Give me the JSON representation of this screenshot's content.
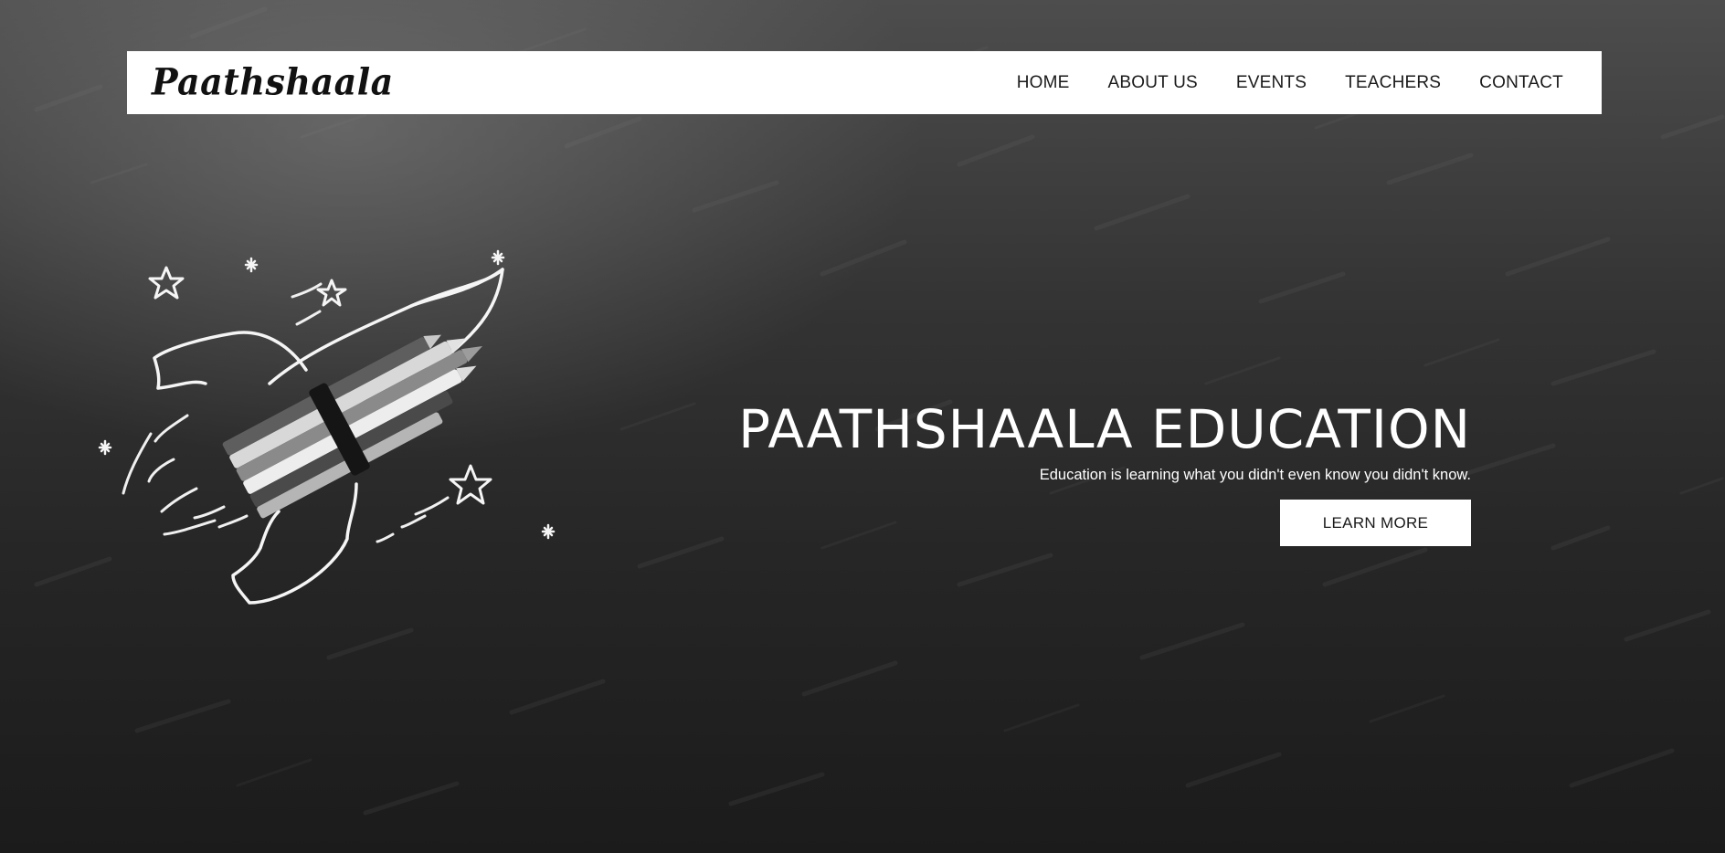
{
  "header": {
    "logo_text": "Paathshaala"
  },
  "nav": {
    "items": [
      {
        "label": "HOME"
      },
      {
        "label": "ABOUT US"
      },
      {
        "label": "EVENTS"
      },
      {
        "label": "TEACHERS"
      },
      {
        "label": "CONTACT"
      }
    ]
  },
  "hero": {
    "title": "PAATHSHAALA EDUCATION",
    "subtitle": "Education is learning what you didn't even know you didn't know.",
    "cta_label": "LEARN MORE"
  },
  "colors": {
    "navbar_bg": "#ffffff",
    "hero_text": "#ffffff",
    "background_dark": "#1b1b1b",
    "background_light": "#4d4d4d"
  }
}
